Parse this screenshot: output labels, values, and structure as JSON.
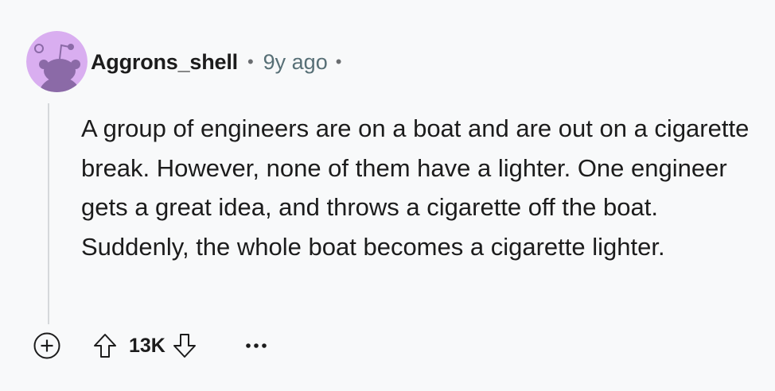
{
  "comment": {
    "author": "Aggrons_shell",
    "separator": "•",
    "time_ago": "9y ago",
    "trailing_separator": "•",
    "body": "A group of engineers are on a boat and are out on a cigarette break. However, none of them have a lighter. One engineer gets a great idea, and throws a cigarette off the boat. Suddenly, the whole boat becomes a cigarette lighter.",
    "score": "13K"
  },
  "icons": {
    "avatar": "snoo-avatar-icon",
    "expand": "plus-circle-icon",
    "upvote": "upvote-arrow-icon",
    "downvote": "downvote-arrow-icon",
    "more": "more-options-icon"
  },
  "colors": {
    "background": "#f8f9fa",
    "avatar_bg": "#d9aef0",
    "avatar_figure": "#8b6aa7",
    "text": "#1c1c1c",
    "muted": "#576f76",
    "thread_line": "#d5d8db"
  }
}
